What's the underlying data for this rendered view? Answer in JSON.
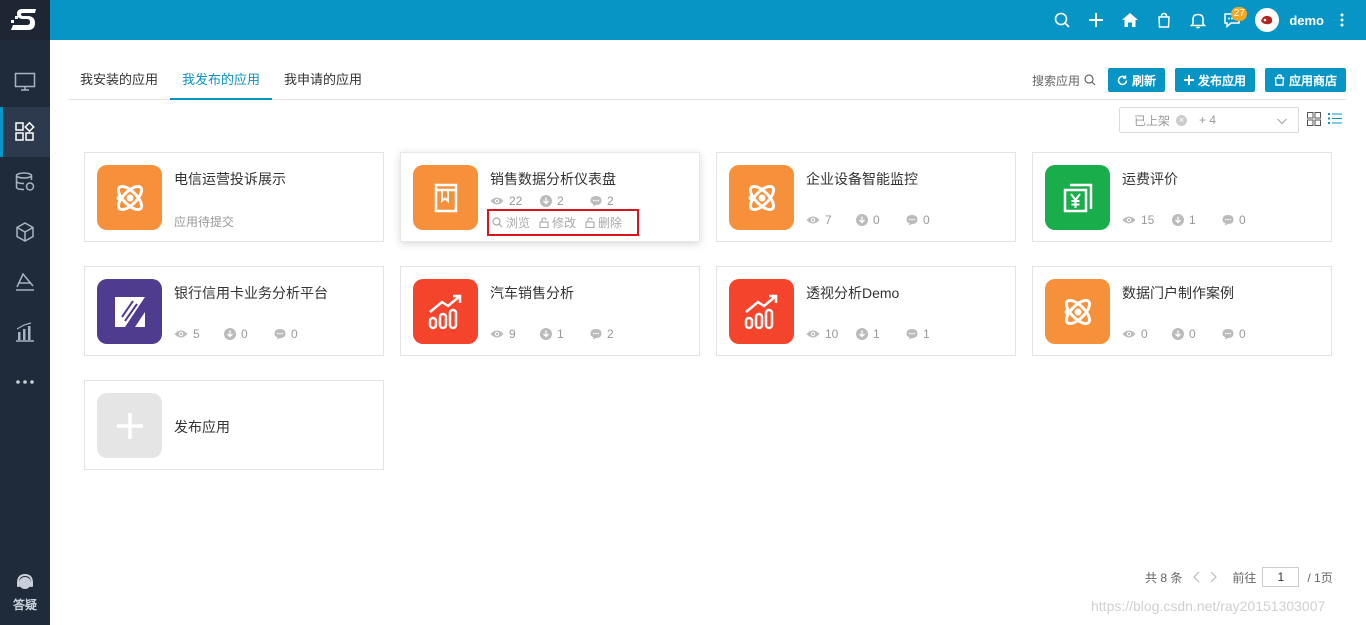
{
  "topbar": {
    "notify_count": "27",
    "user_name": "demo"
  },
  "sidebar": {
    "help_label": "答疑"
  },
  "tabs": [
    {
      "label": "我安装的应用"
    },
    {
      "label": "我发布的应用"
    },
    {
      "label": "我申请的应用"
    }
  ],
  "toolbar": {
    "search_label": "搜索应用",
    "refresh_label": "刷新",
    "publish_label": "发布应用",
    "store_label": "应用商店"
  },
  "filter": {
    "tag": "已上架",
    "more": "+ 4"
  },
  "colors": {
    "primary": "#0795c5",
    "orange": "#f7903a",
    "green": "#1aad4b",
    "purple": "#4f3c8e",
    "red": "#f4452c"
  },
  "cards": [
    {
      "title": "电信运营投诉展示",
      "status": "应用待提交"
    },
    {
      "title": "销售数据分析仪表盘",
      "views": "22",
      "downloads": "2",
      "comments": "2",
      "actions": {
        "view": "浏览",
        "edit": "修改",
        "delete": "删除"
      }
    },
    {
      "title": "企业设备智能监控",
      "views": "7",
      "downloads": "0",
      "comments": "0"
    },
    {
      "title": "运费评价",
      "views": "15",
      "downloads": "1",
      "comments": "0"
    },
    {
      "title": "银行信用卡业务分析平台",
      "views": "5",
      "downloads": "0",
      "comments": "0"
    },
    {
      "title": "汽车销售分析",
      "views": "9",
      "downloads": "1",
      "comments": "2"
    },
    {
      "title": "透视分析Demo",
      "views": "10",
      "downloads": "1",
      "comments": "1"
    },
    {
      "title": "数据门户制作案例",
      "views": "0",
      "downloads": "0",
      "comments": "0"
    },
    {
      "title": "发布应用"
    }
  ],
  "pager": {
    "total": "共 8 条",
    "goto": "前往",
    "page": "1",
    "pages": "/ 1页"
  },
  "watermark": "https://blog.csdn.net/ray20151303007"
}
